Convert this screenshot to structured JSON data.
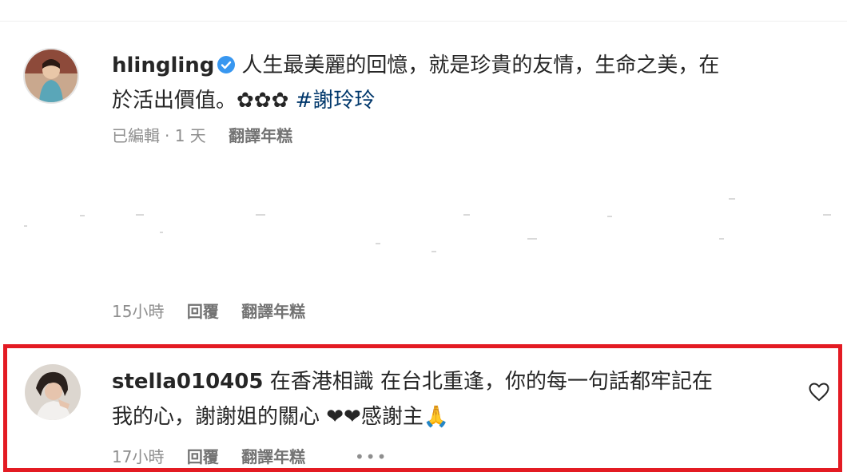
{
  "post": {
    "username": "hlingling",
    "caption_line1": "人生最美麗的回憶，就是珍貴的友情，生命之美，在",
    "caption_line2": "於活出價值。✿✿✿",
    "hashtag": "#謝玲玲",
    "edited": "已編輯",
    "time": "· 1 天",
    "translate": "翻譯年糕"
  },
  "reply": {
    "time": "15小時",
    "reply_label": "回覆",
    "translate": "翻譯年糕"
  },
  "comment": {
    "username": "stella010405",
    "text_line1": "在香港相識 在台北重逢，你的每一句話都牢記在",
    "text_line2": "我的心，謝謝姐的關心 ❤❤感謝主🙏",
    "time": "17小時",
    "reply_label": "回覆",
    "translate": "翻譯年糕",
    "more": "•••"
  },
  "colors": {
    "highlight": "#e31b23",
    "verified": "#3897f0",
    "hashtag": "#00376b"
  }
}
